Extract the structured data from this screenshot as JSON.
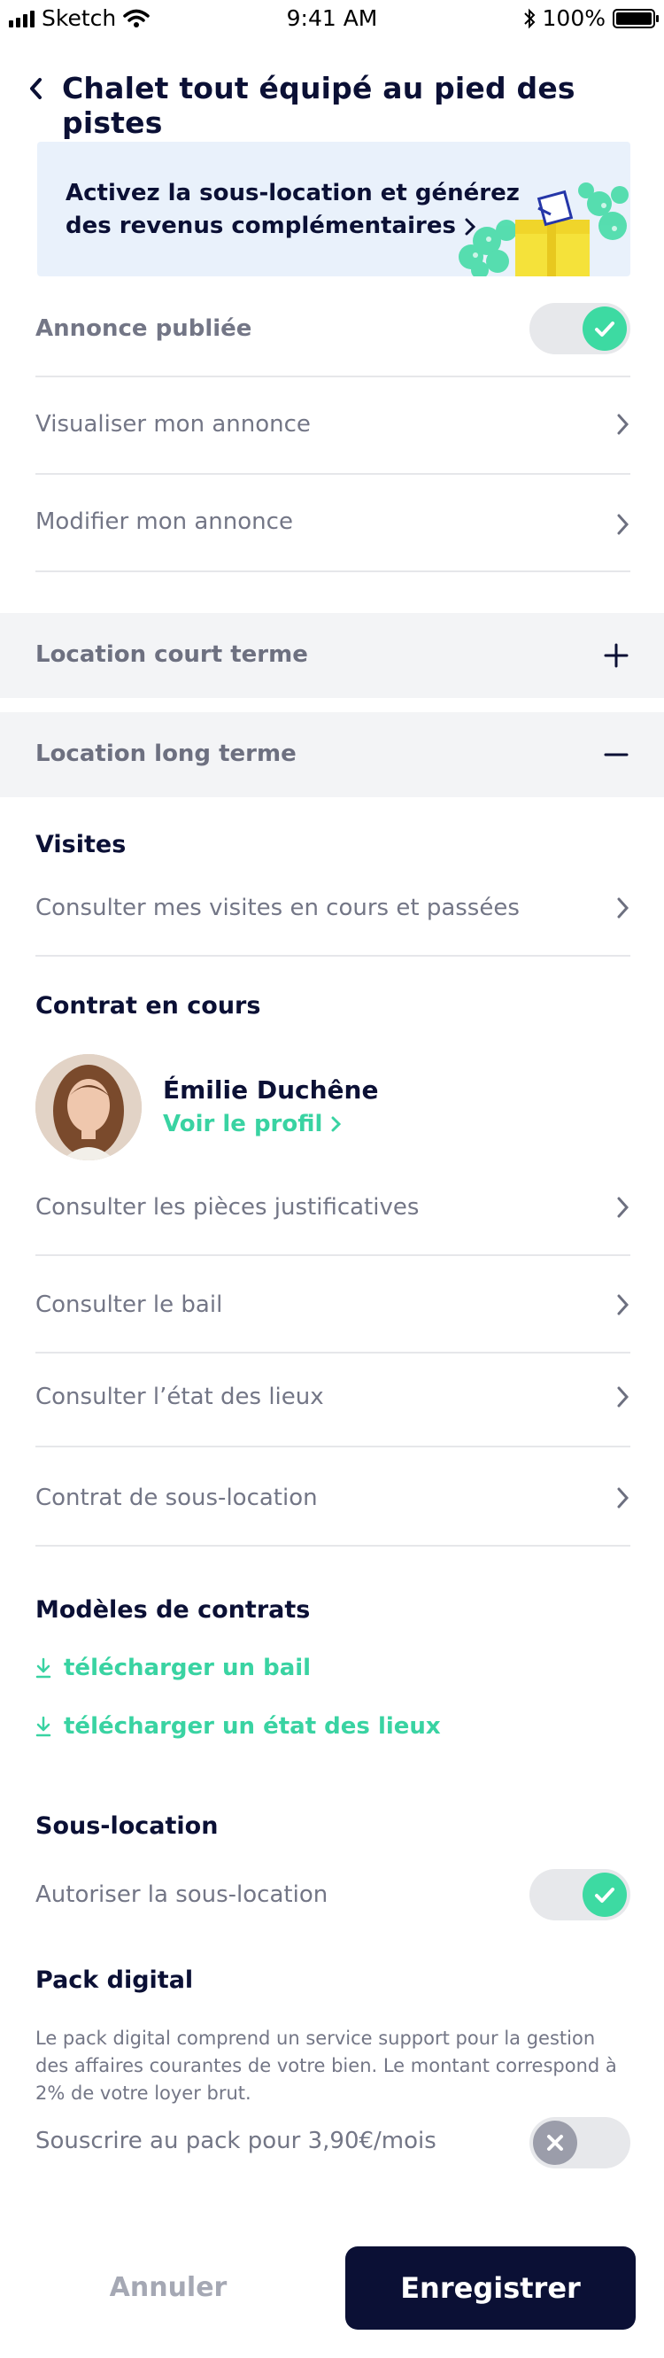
{
  "status_bar": {
    "carrier": "Sketch",
    "time": "9:41 AM",
    "battery": "100%"
  },
  "header": {
    "title": "Chalet tout équipé au pied des pistes"
  },
  "banner": {
    "line1": "Activez la sous-location et générez",
    "line2": "des revenus complémentaires"
  },
  "annonce": {
    "published_label": "Annonce publiée",
    "published": true,
    "view_label": "Visualiser mon annonce",
    "edit_label": "Modifier mon annonce"
  },
  "sections": {
    "short_term": {
      "label": "Location court terme",
      "expanded": false
    },
    "long_term": {
      "label": "Location long terme",
      "expanded": true
    }
  },
  "visites": {
    "title": "Visites",
    "link": "Consulter mes visites en cours et passées"
  },
  "contract": {
    "title": "Contrat en cours",
    "tenant_name": "Émilie Duchêne",
    "profile_link": "Voir le profil",
    "items": [
      "Consulter les pièces justificatives",
      "Consulter le bail",
      "Consulter l’état des lieux",
      "Contrat de sous-location"
    ]
  },
  "templates": {
    "title": "Modèles de contrats",
    "downloads": [
      "télécharger un bail",
      "télécharger un état des lieux"
    ]
  },
  "sublet": {
    "title": "Sous-location",
    "toggle_label": "Autoriser la sous-location",
    "enabled": true
  },
  "pack": {
    "title": "Pack digital",
    "description_lines": [
      "Le pack digital comprend un service support pour la gestion",
      "des affaires courantes de votre bien. Le montant correspond à",
      "2% de votre loyer brut."
    ],
    "subscribe_label": "Souscrire au pack pour 3,90€/mois",
    "subscribed": false
  },
  "footer": {
    "cancel_label": "Annuler",
    "save_label": "Enregistrer"
  },
  "colors": {
    "accent": "#39d3a2",
    "navy": "#0b1035",
    "banner_bg": "#e9f1fb",
    "section_bg": "#f3f4f6"
  }
}
